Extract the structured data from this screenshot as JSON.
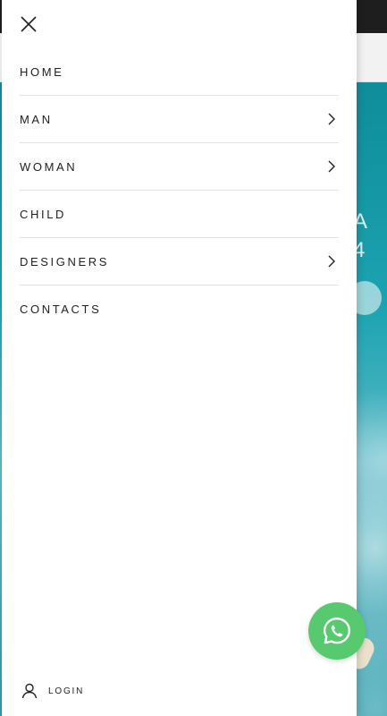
{
  "menu": {
    "items": [
      {
        "label": "HOME",
        "has_submenu": false
      },
      {
        "label": "MAN",
        "has_submenu": true
      },
      {
        "label": "WOMAN",
        "has_submenu": true
      },
      {
        "label": "CHILD",
        "has_submenu": false
      },
      {
        "label": "DESIGNERS",
        "has_submenu": true
      },
      {
        "label": "CONTACTS",
        "has_submenu": false
      }
    ]
  },
  "footer": {
    "login_label": "LOGIN"
  },
  "background": {
    "hero_text_line1": "A",
    "hero_text_line2": "4"
  },
  "icons": {
    "close": "close-icon",
    "chevron": "chevron-right-icon",
    "user": "user-icon",
    "whatsapp": "whatsapp-icon",
    "cart": "basket-icon"
  },
  "colors": {
    "whatsapp_green": "#57c96e",
    "text": "#222222",
    "divider": "#e3e3e3"
  }
}
